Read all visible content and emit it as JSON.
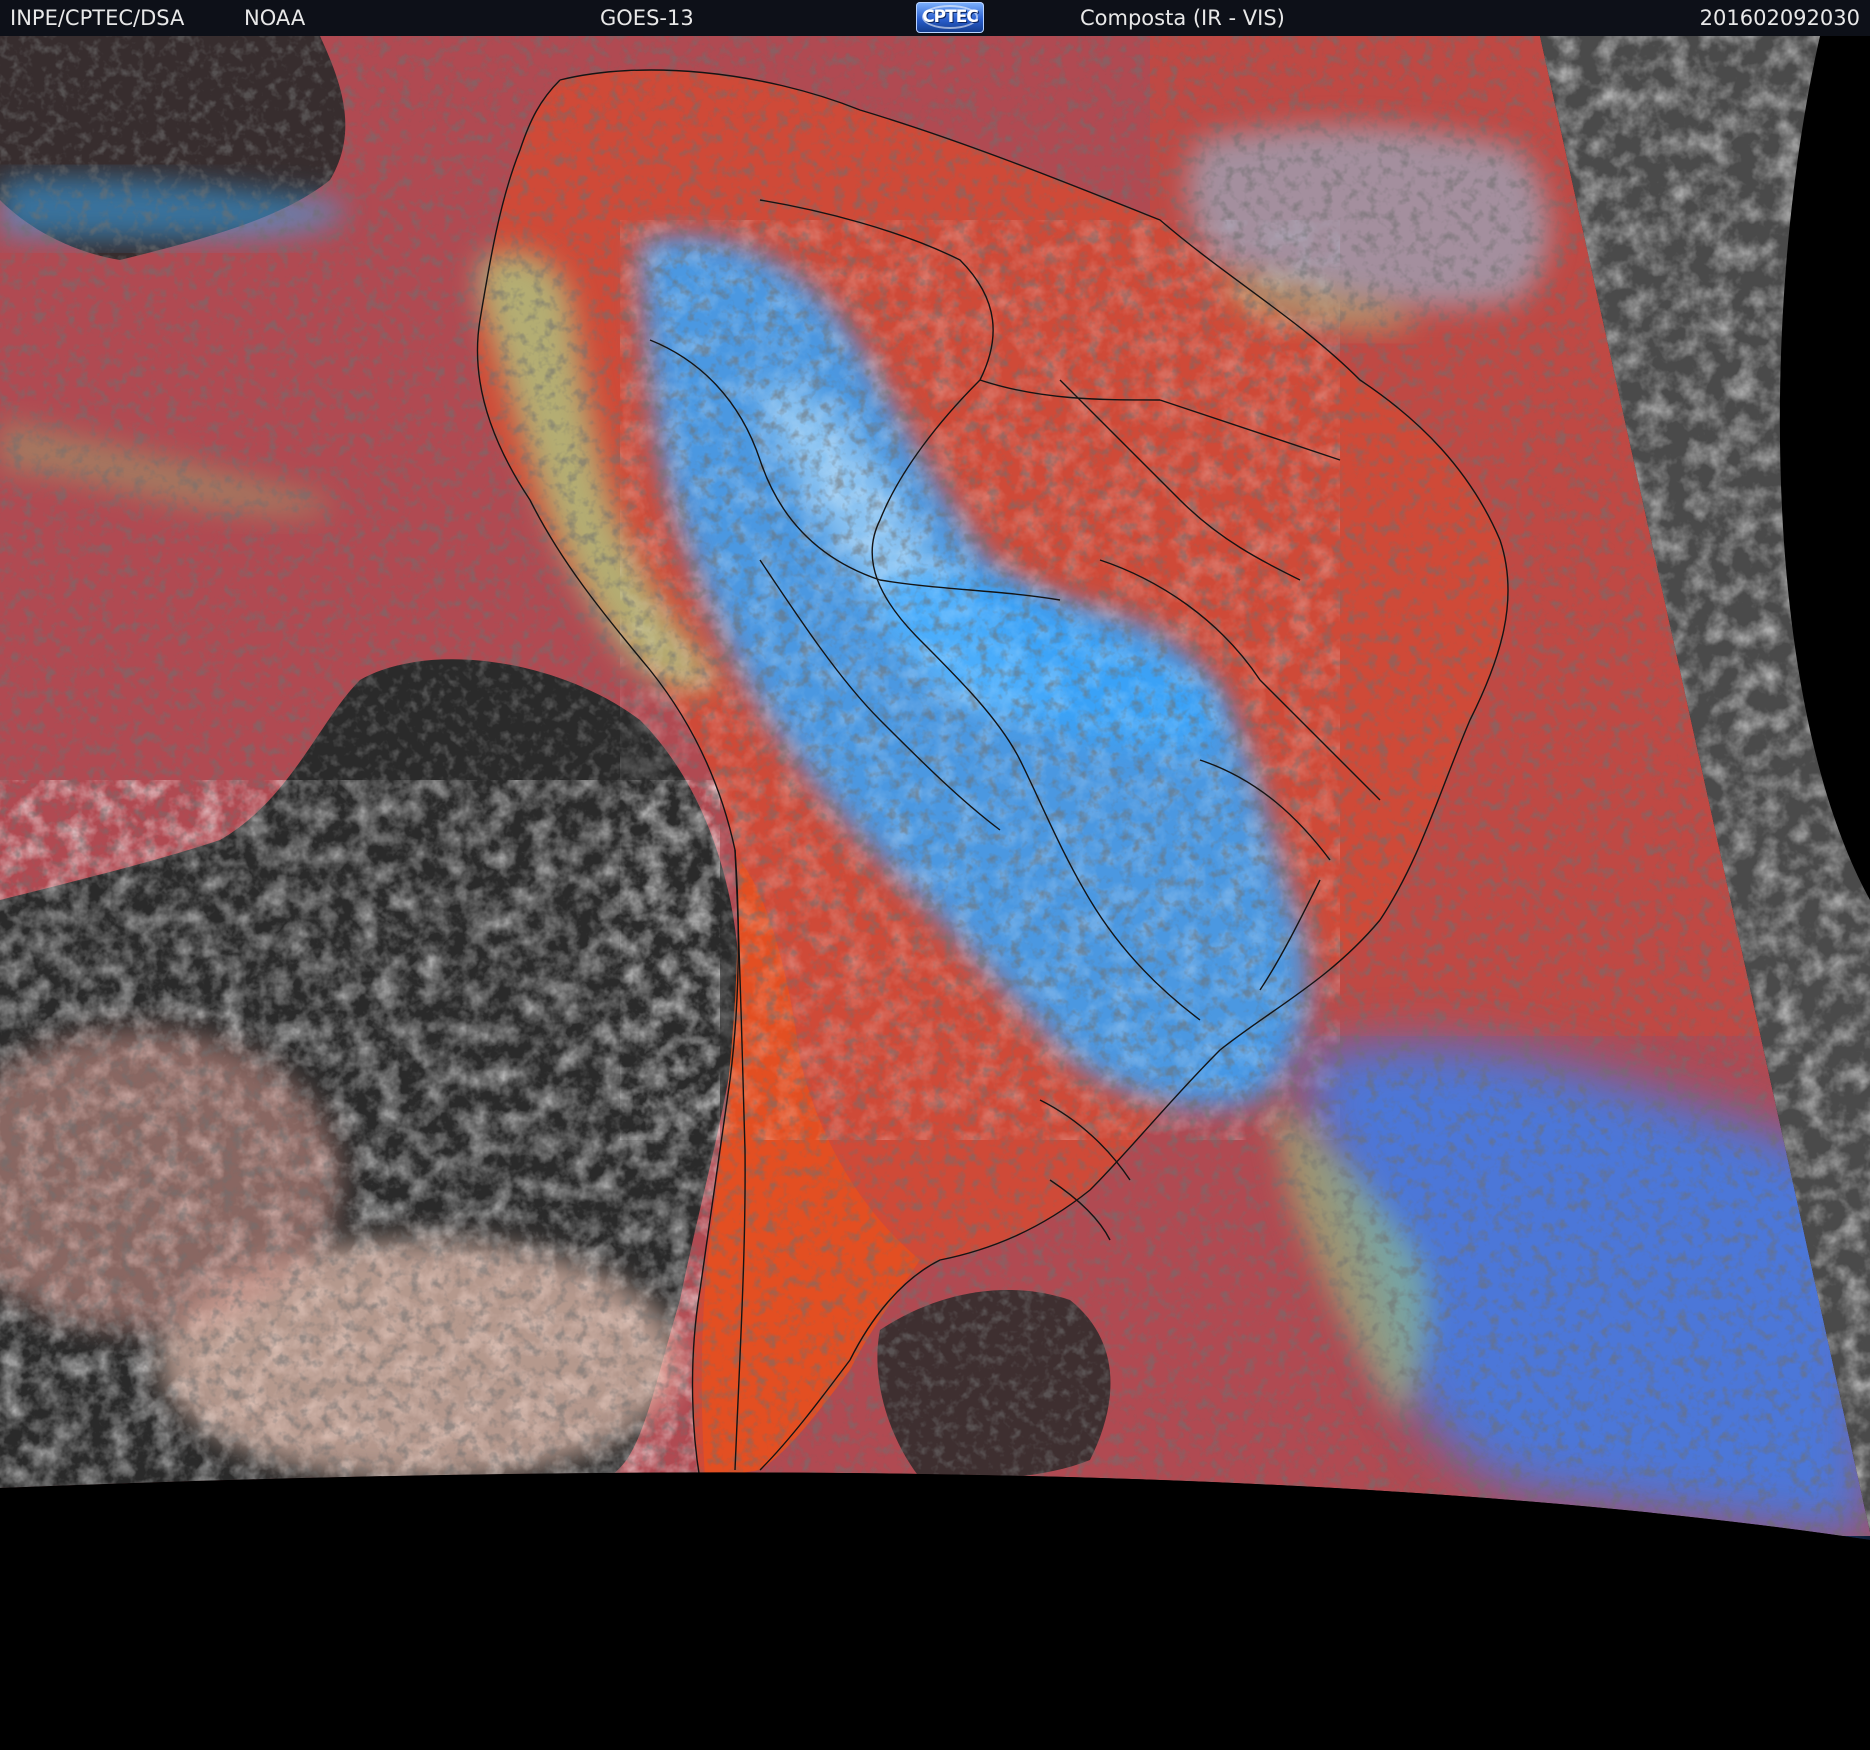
{
  "header": {
    "agency": "INPE/CPTEC/DSA",
    "partner": "NOAA",
    "satellite": "GOES-13",
    "logo_text": "CPTEC",
    "product": "Composta (IR - VIS)",
    "timestamp": "201602092030"
  },
  "colors": {
    "header_background": "#0d1018",
    "header_text": "#e8e8e8",
    "clear_ocean": "#b04a52",
    "clear_land": "#cf4a38",
    "high_cloud": "#36a6ff",
    "low_cloud": "#e8a89a",
    "night_cloud": "#8a8a8a",
    "no_data": "#000000",
    "borders": "#141414"
  }
}
